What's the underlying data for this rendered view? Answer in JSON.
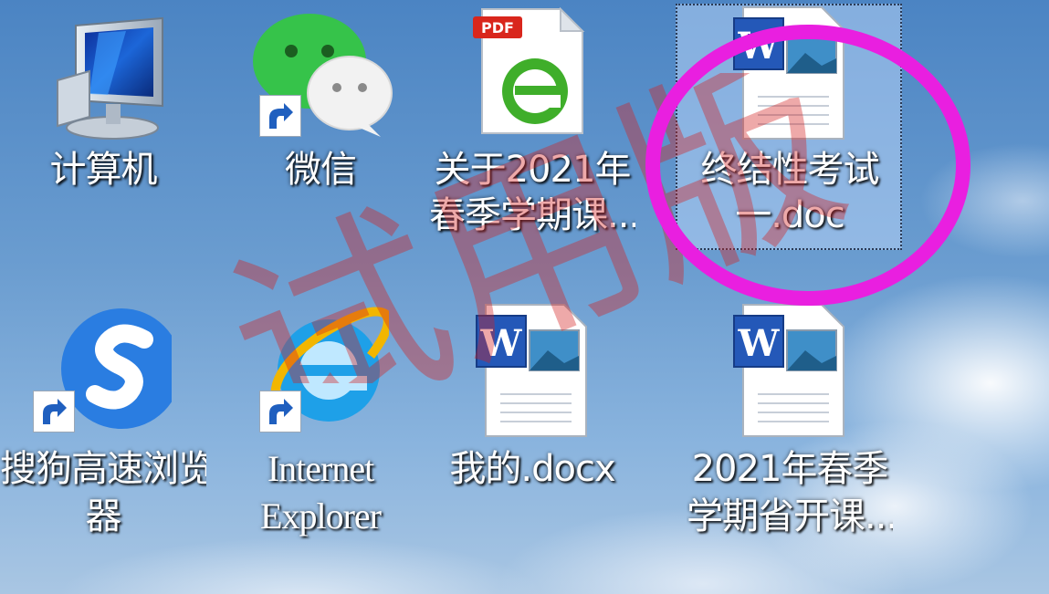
{
  "desktop": {
    "icons": [
      {
        "id": "computer",
        "label": "计算机",
        "kind": "computer-icon"
      },
      {
        "id": "wechat",
        "label": "微信",
        "kind": "wechat-icon"
      },
      {
        "id": "pdf-doc",
        "label_line1": "关于2021年",
        "label_line2": "春季学期课...",
        "kind": "pdf-icon",
        "badge": "PDF"
      },
      {
        "id": "exam-doc",
        "label_line1": "终结性考试",
        "label_line2": "一.doc",
        "kind": "word-doc-icon",
        "selected": true
      },
      {
        "id": "sogou",
        "label_line1": "搜狗高速浏览",
        "label_line2": "器",
        "kind": "sogou-browser-icon"
      },
      {
        "id": "ie",
        "label_line1": "Internet",
        "label_line2": "Explorer",
        "kind": "internet-explorer-icon"
      },
      {
        "id": "my-docx",
        "label": "我的.docx",
        "kind": "word-doc-icon"
      },
      {
        "id": "course-doc",
        "label_line1": "2021年春季",
        "label_line2": "学期省开课...",
        "kind": "word-doc-icon"
      }
    ],
    "watermark_text": "试用版",
    "colors": {
      "annotation_circle": "#e91fe0",
      "watermark": "#d42020",
      "selection": "#b4d2f5"
    }
  }
}
